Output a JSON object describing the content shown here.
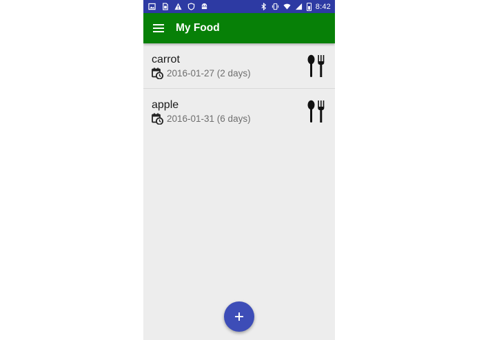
{
  "status_bar": {
    "time": "8:42",
    "left_icons": [
      "image-icon",
      "sim-icon",
      "warning-icon",
      "shield-icon",
      "android-icon"
    ],
    "right_icons": [
      "bluetooth-icon",
      "vibrate-icon",
      "wifi-icon",
      "signal-icon",
      "battery-icon"
    ]
  },
  "app_bar": {
    "title": "My Food",
    "menu_icon": "menu-icon",
    "color": "#078007"
  },
  "items": [
    {
      "name": "carrot",
      "date": "2016-01-27 (2 days)",
      "date_icon": "calendar-clock-icon",
      "action_icon": "spoon-fork-icon"
    },
    {
      "name": "apple",
      "date": "2016-01-31 (6 days)",
      "date_icon": "calendar-clock-icon",
      "action_icon": "spoon-fork-icon"
    }
  ],
  "fab": {
    "icon": "plus-icon",
    "color": "#3d4db7"
  },
  "colors": {
    "status_bar": "#2d3aa3",
    "background": "#ededed"
  }
}
